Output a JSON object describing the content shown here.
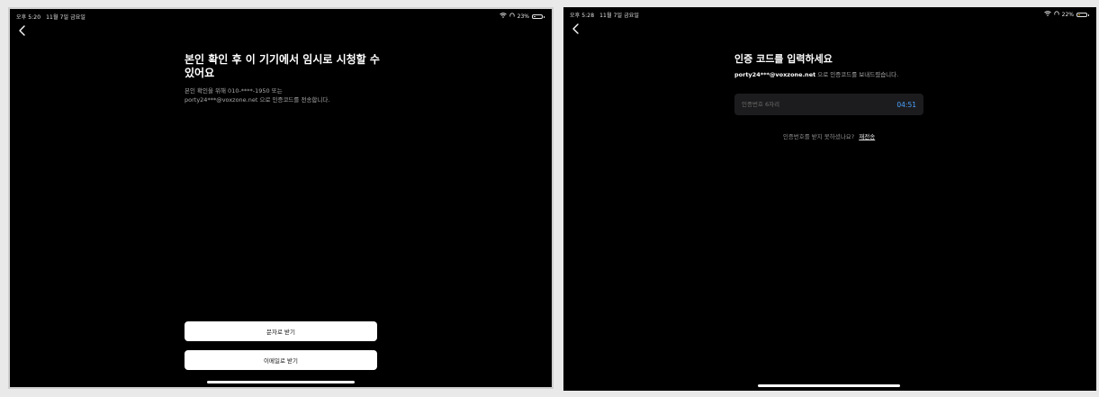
{
  "left_screen": {
    "status": {
      "time": "오후 5:20",
      "date": "11월 7일 금요일",
      "battery": "23%",
      "battery_level": 0.23
    },
    "back_icon": "chevron-left-icon",
    "title": "본인 확인 후 이 기기에서 임시로 시청할 수 있어요",
    "description_line1": "본인 확인을 위해 010-****-1950 또는",
    "description_line2": "porty24***@voxzone.net 으로 인증코드를 전송합니다.",
    "buttons": {
      "sms": "문자로 받기",
      "email": "이메일로 받기"
    }
  },
  "right_screen": {
    "status": {
      "time": "오후 5:28",
      "date": "11월 7일 금요일",
      "battery": "22%",
      "battery_level": 0.22,
      "charging": true
    },
    "back_icon": "chevron-left-icon",
    "title": "인증 코드를 입력하세요",
    "subtitle_email": "porty24***@voxzone.net",
    "subtitle_rest": " 으로 인증코드를 보내드렸습니다.",
    "code_input": {
      "placeholder": "인증번호 6자리",
      "value": ""
    },
    "timer": "04:51",
    "resend_prompt": "인증번호를 받지 못하셨나요?",
    "resend_link": "재전송"
  },
  "colors": {
    "background": "#000000",
    "accent_timer": "#4aa3ff",
    "button_bg": "#ffffff"
  }
}
